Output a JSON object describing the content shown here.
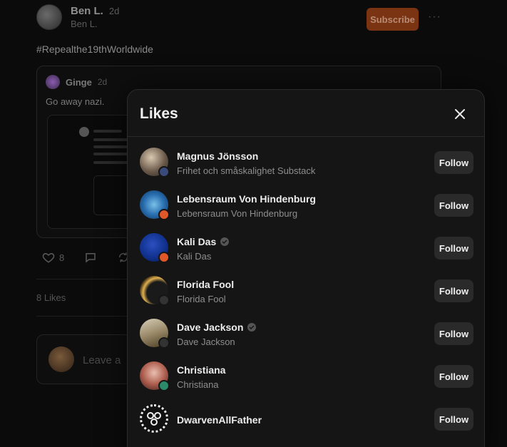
{
  "post": {
    "author_name": "Ben L.",
    "age": "2d",
    "handle": "Ben L.",
    "subscribe_label": "Subscribe",
    "more_label": "···",
    "body": "#Repealthe19thWorldwide",
    "quote": {
      "author_name": "Ginge",
      "age": "2d",
      "text": "Go away nazi."
    },
    "actions": {
      "like_count": "8"
    },
    "likes_summary": "8 Likes",
    "comment_placeholder": "Leave a"
  },
  "modal": {
    "title": "Likes",
    "users": [
      {
        "name": "Magnus Jönsson",
        "subtitle": "Frihet och småskalighet Substack",
        "follow_label": "Follow",
        "avatar_color": "#6b5a4a",
        "badge_color": "#3a4a7a",
        "verified": false
      },
      {
        "name": "Lebensraum Von Hindenburg",
        "subtitle": "Lebensraum Von Hindenburg",
        "follow_label": "Follow",
        "avatar_color": "#2a6fb0",
        "badge_color": "#e0572a",
        "verified": false
      },
      {
        "name": "Kali Das",
        "subtitle": "Kali Das",
        "follow_label": "Follow",
        "avatar_color": "#0f2f8a",
        "badge_color": "#e0572a",
        "verified": true
      },
      {
        "name": "Florida Fool",
        "subtitle": "Florida Fool",
        "follow_label": "Follow",
        "avatar_color": "#c99a3a",
        "badge_color": "#333333",
        "verified": false
      },
      {
        "name": "Dave Jackson",
        "subtitle": "Dave Jackson",
        "follow_label": "Follow",
        "avatar_color": "#9a8a6a",
        "badge_color": "#333333",
        "verified": true
      },
      {
        "name": "Christiana",
        "subtitle": "Christiana",
        "follow_label": "Follow",
        "avatar_color": "#8a3a3a",
        "badge_color": "#2a8a6a",
        "verified": false
      },
      {
        "name": "DwarvenAllFather",
        "subtitle": "",
        "follow_label": "Follow",
        "avatar_color": "#111111",
        "badge_color": "",
        "verified": false
      }
    ]
  }
}
